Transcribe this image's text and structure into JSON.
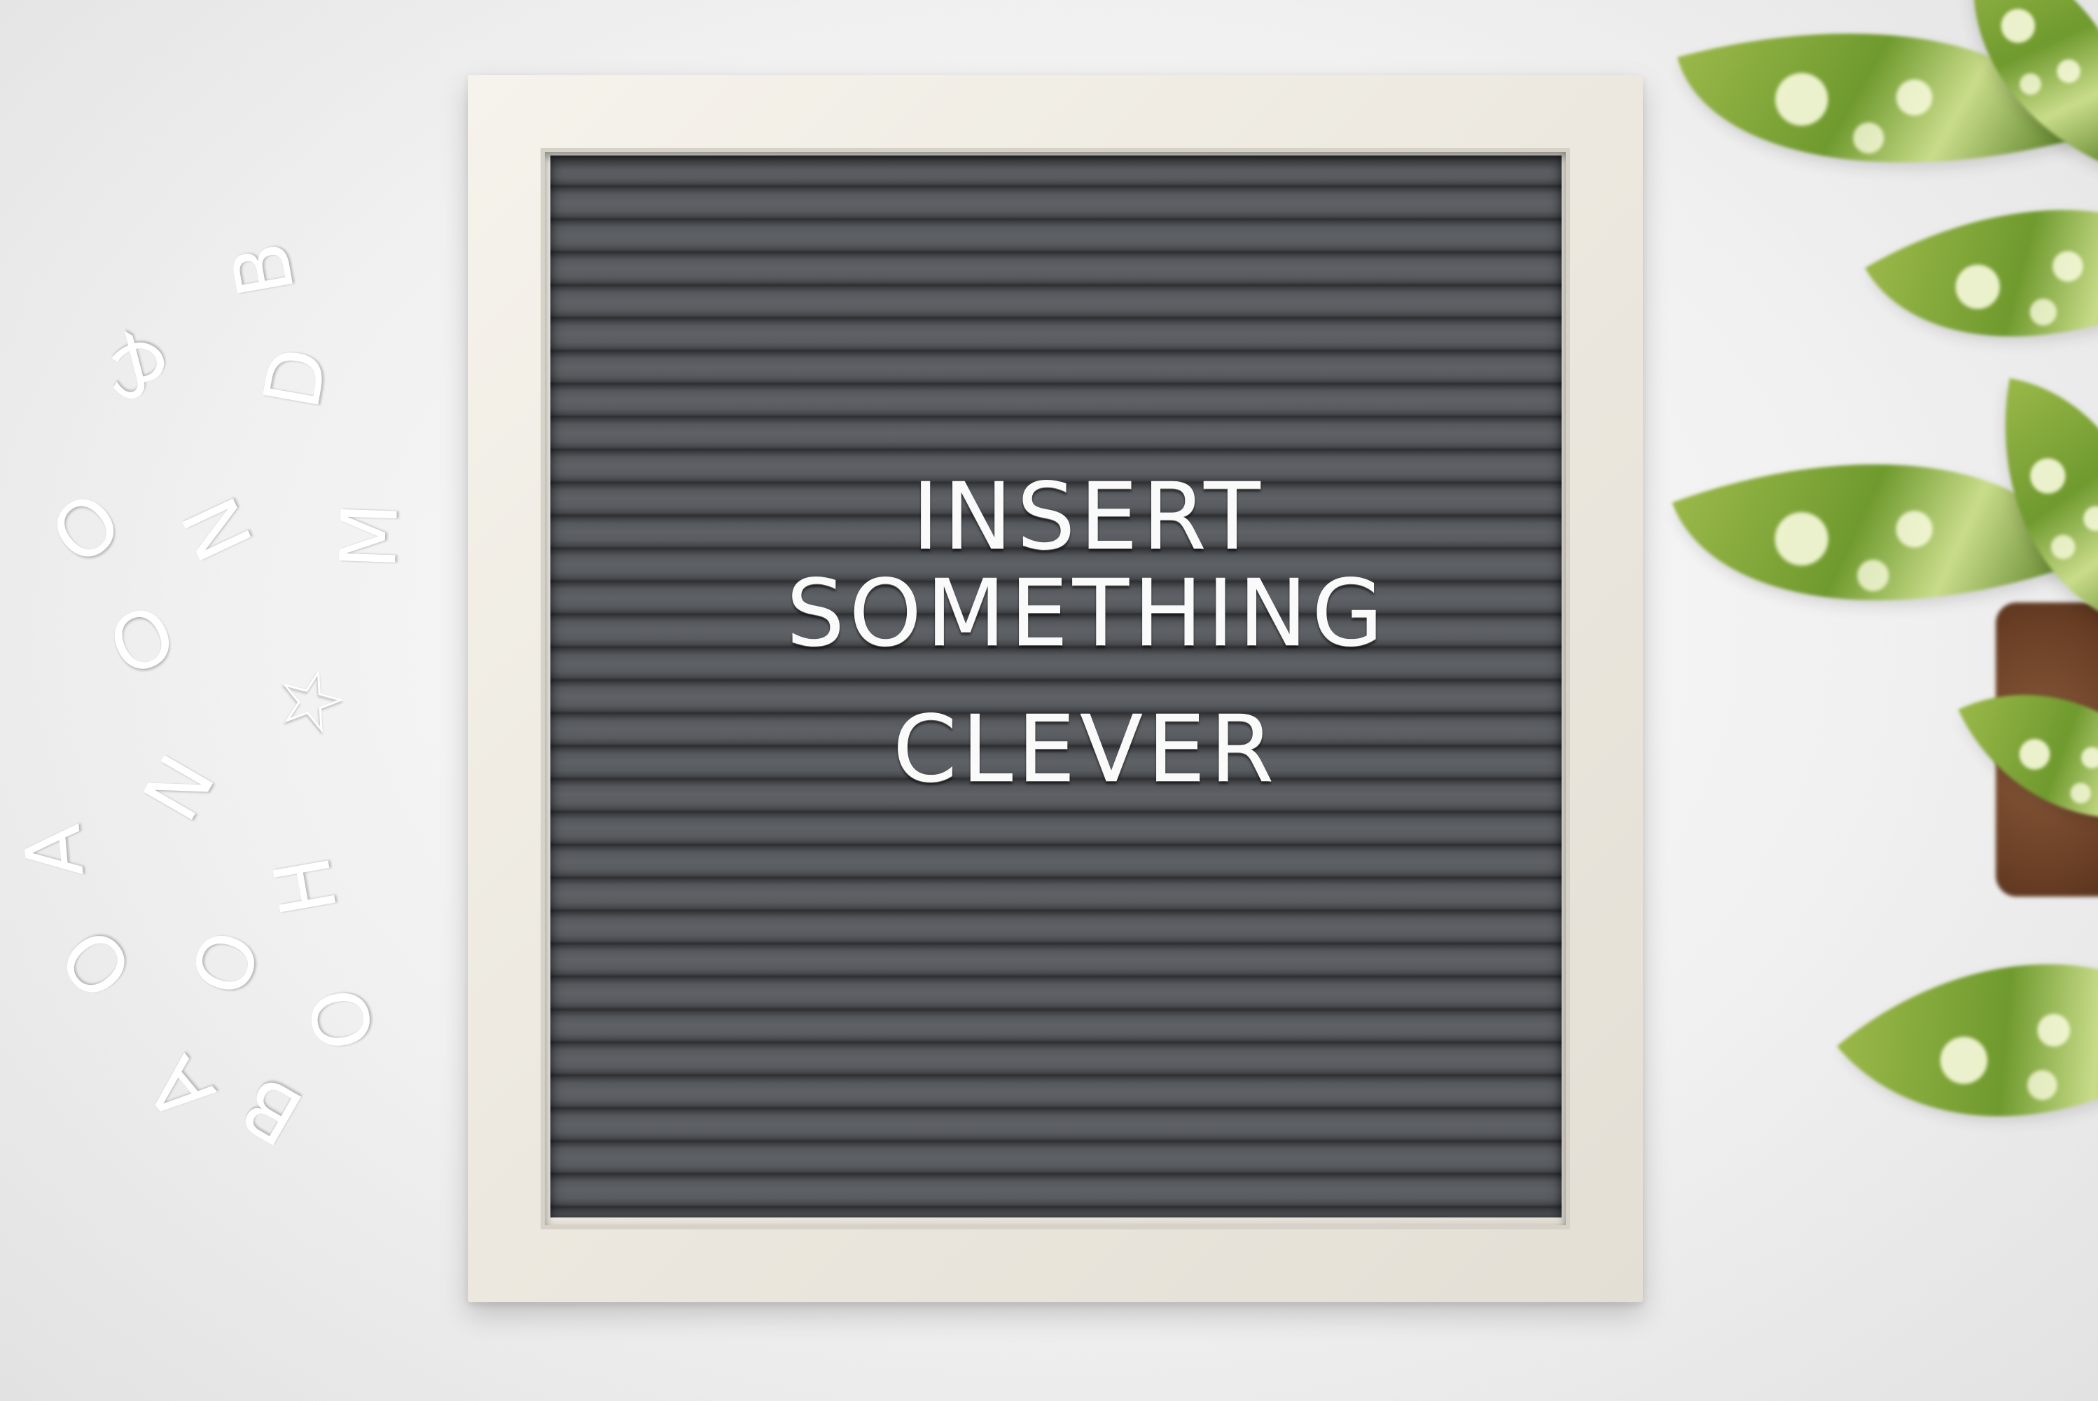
{
  "board": {
    "line1": "INSERT",
    "line2": "SOMETHING",
    "line3": "CLEVER"
  },
  "loose_letters": [
    "B",
    "&",
    "D",
    "O",
    "N",
    "M",
    "O",
    "☆",
    "N",
    "A",
    "H",
    "O",
    "O",
    "O",
    "B",
    "A"
  ],
  "colors": {
    "felt": "#4f5256",
    "frame": "#efece4",
    "letters": "#ffffff",
    "leaf": "#7fa33a",
    "pot": "#6a3f25"
  }
}
